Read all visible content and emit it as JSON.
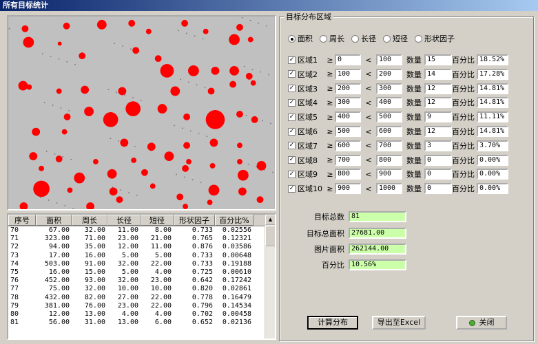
{
  "window": {
    "title": "所有目标统计"
  },
  "table": {
    "headers": [
      "序号",
      "面积",
      "周长",
      "长径",
      "短径",
      "形状因子",
      "百分比%"
    ],
    "rows": [
      [
        "70",
        "67.00",
        "32.00",
        "11.00",
        "8.00",
        "0.733",
        "0.02556"
      ],
      [
        "71",
        "323.00",
        "71.00",
        "23.00",
        "21.00",
        "0.765",
        "0.12321"
      ],
      [
        "72",
        "94.00",
        "35.00",
        "12.00",
        "11.00",
        "0.876",
        "0.03586"
      ],
      [
        "73",
        "17.00",
        "16.00",
        "5.00",
        "5.00",
        "0.733",
        "0.00648"
      ],
      [
        "74",
        "503.00",
        "91.00",
        "32.00",
        "22.00",
        "0.733",
        "0.19188"
      ],
      [
        "75",
        "16.00",
        "15.00",
        "5.00",
        "4.00",
        "0.725",
        "0.00610"
      ],
      [
        "76",
        "452.00",
        "93.00",
        "32.00",
        "23.00",
        "0.642",
        "0.17242"
      ],
      [
        "77",
        "75.00",
        "32.00",
        "10.00",
        "10.00",
        "0.820",
        "0.02861"
      ],
      [
        "78",
        "432.00",
        "82.00",
        "27.00",
        "22.00",
        "0.778",
        "0.16479"
      ],
      [
        "79",
        "381.00",
        "76.00",
        "23.00",
        "22.00",
        "0.796",
        "0.14534"
      ],
      [
        "80",
        "12.00",
        "13.00",
        "4.00",
        "4.00",
        "0.702",
        "0.00458"
      ],
      [
        "81",
        "56.00",
        "31.00",
        "13.00",
        "6.00",
        "0.652",
        "0.02136"
      ]
    ]
  },
  "group_title": "目标分布区域",
  "radios": [
    {
      "label": "面积",
      "selected": true
    },
    {
      "label": "周长",
      "selected": false
    },
    {
      "label": "长径",
      "selected": false
    },
    {
      "label": "短径",
      "selected": false
    },
    {
      "label": "形状因子",
      "selected": false
    }
  ],
  "labels": {
    "ge": "≥",
    "lt": "<",
    "count": "数量",
    "percent": "百分比",
    "check": "✓"
  },
  "regions": [
    {
      "name": "区域1",
      "min": "0",
      "max": "100",
      "count": "15",
      "percent": "18.52%"
    },
    {
      "name": "区域2",
      "min": "100",
      "max": "200",
      "count": "14",
      "percent": "17.28%"
    },
    {
      "name": "区域3",
      "min": "200",
      "max": "300",
      "count": "12",
      "percent": "14.81%"
    },
    {
      "name": "区域4",
      "min": "300",
      "max": "400",
      "count": "12",
      "percent": "14.81%"
    },
    {
      "name": "区域5",
      "min": "400",
      "max": "500",
      "count": "9",
      "percent": "11.11%"
    },
    {
      "name": "区域6",
      "min": "500",
      "max": "600",
      "count": "12",
      "percent": "14.81%"
    },
    {
      "name": "区域7",
      "min": "600",
      "max": "700",
      "count": "3",
      "percent": "3.70%"
    },
    {
      "name": "区域8",
      "min": "700",
      "max": "800",
      "count": "0",
      "percent": "0.00%"
    },
    {
      "name": "区域9",
      "min": "800",
      "max": "900",
      "count": "0",
      "percent": "0.00%"
    },
    {
      "name": "区域10",
      "min": "900",
      "max": "1000",
      "count": "0",
      "percent": "0.00%"
    }
  ],
  "stats": {
    "total_targets_label": "目标总数",
    "total_targets": "81",
    "total_area_label": "目标总面积",
    "total_area": "27681.00",
    "image_area_label": "图片面积",
    "image_area": "262144.00",
    "percent_label": "百分比",
    "percent": "10.56%"
  },
  "buttons": {
    "compute": "计算分布",
    "export": "导出至Excel",
    "close": "关闭"
  },
  "colors": {
    "particle": "#ff0000",
    "stat_field": "#ccffaa",
    "title_bar": "#0a246a"
  }
}
